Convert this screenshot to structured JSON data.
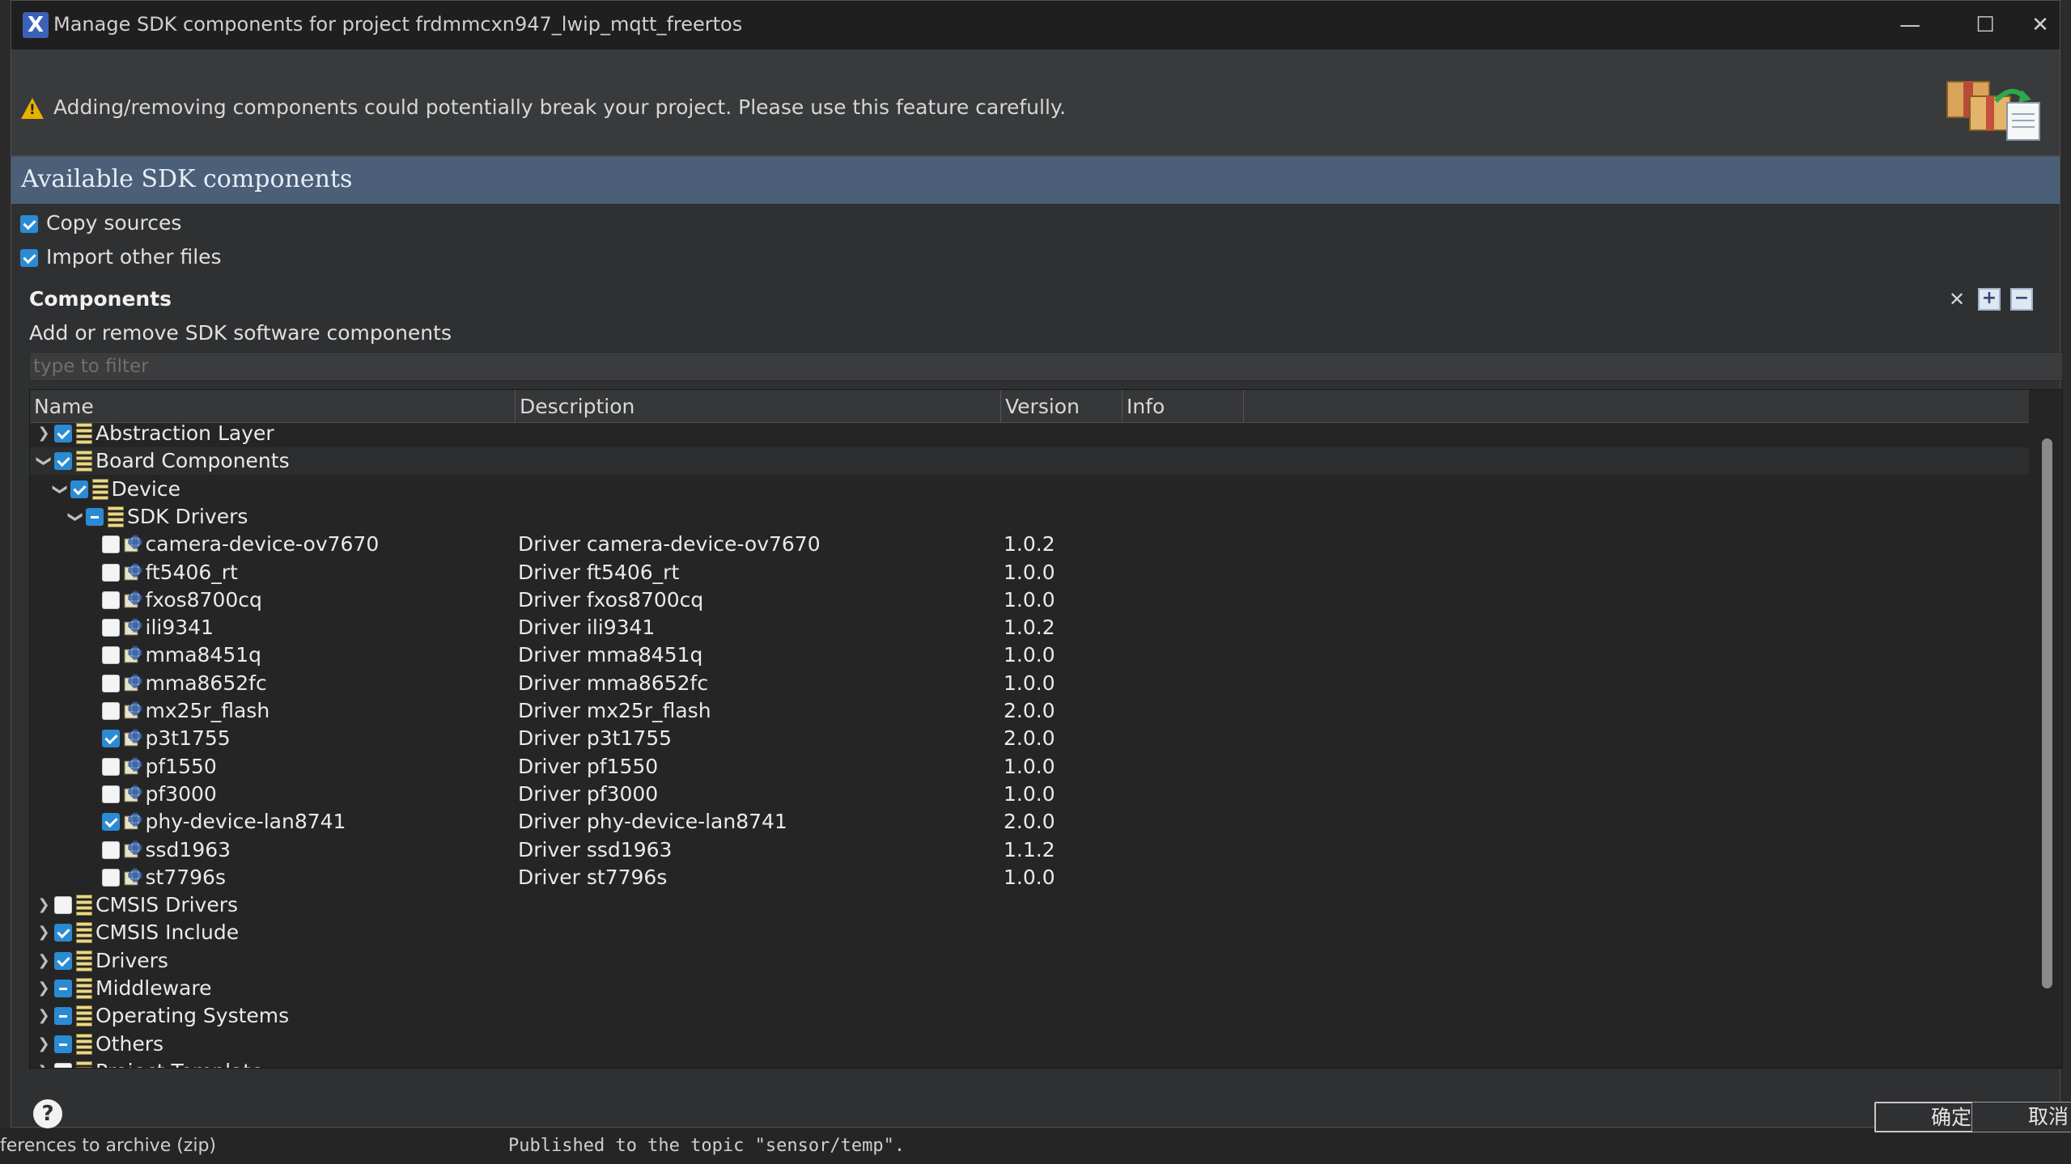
{
  "window": {
    "title": "Manage SDK components for project frdmmcxn947_lwip_mqtt_freertos",
    "minimize_glyph": "—",
    "maximize_glyph": "☐",
    "close_glyph": "✕"
  },
  "banner": {
    "warning": "Adding/removing components could potentially break your project. Please use this feature carefully."
  },
  "section": {
    "title": "Available SDK components"
  },
  "options": {
    "copy_sources": {
      "label": "Copy sources",
      "checked": true
    },
    "import_other_files": {
      "label": "Import other files",
      "checked": true
    }
  },
  "components": {
    "title": "Components",
    "subtitle": "Add or remove SDK software components",
    "filter_placeholder": "type to filter",
    "toolbar_icons": [
      "clear-filter-icon",
      "expand-all-icon",
      "collapse-all-icon"
    ]
  },
  "table": {
    "columns": [
      "Name",
      "Description",
      "Version",
      "Info"
    ],
    "rows": [
      {
        "level": 0,
        "expander": "collapsed",
        "check": "on",
        "icon": "group",
        "name": "Abstraction Layer",
        "desc": "",
        "ver": ""
      },
      {
        "level": 0,
        "expander": "expanded",
        "check": "on",
        "icon": "group",
        "name": "Board Components",
        "desc": "",
        "ver": ""
      },
      {
        "level": 1,
        "expander": "expanded",
        "check": "on",
        "icon": "group",
        "name": "Device",
        "desc": "",
        "ver": ""
      },
      {
        "level": 2,
        "expander": "expanded",
        "check": "partial",
        "icon": "group",
        "name": "SDK Drivers",
        "desc": "",
        "ver": ""
      },
      {
        "level": 3,
        "expander": "none",
        "check": "off",
        "icon": "driver",
        "name": "camera-device-ov7670",
        "desc": "Driver camera-device-ov7670",
        "ver": "1.0.2"
      },
      {
        "level": 3,
        "expander": "none",
        "check": "off",
        "icon": "driver",
        "name": "ft5406_rt",
        "desc": "Driver ft5406_rt",
        "ver": "1.0.0"
      },
      {
        "level": 3,
        "expander": "none",
        "check": "off",
        "icon": "driver",
        "name": "fxos8700cq",
        "desc": "Driver fxos8700cq",
        "ver": "1.0.0"
      },
      {
        "level": 3,
        "expander": "none",
        "check": "off",
        "icon": "driver",
        "name": "ili9341",
        "desc": "Driver ili9341",
        "ver": "1.0.2"
      },
      {
        "level": 3,
        "expander": "none",
        "check": "off",
        "icon": "driver",
        "name": "mma8451q",
        "desc": "Driver mma8451q",
        "ver": "1.0.0"
      },
      {
        "level": 3,
        "expander": "none",
        "check": "off",
        "icon": "driver",
        "name": "mma8652fc",
        "desc": "Driver mma8652fc",
        "ver": "1.0.0"
      },
      {
        "level": 3,
        "expander": "none",
        "check": "off",
        "icon": "driver",
        "name": "mx25r_flash",
        "desc": "Driver mx25r_flash",
        "ver": "2.0.0"
      },
      {
        "level": 3,
        "expander": "none",
        "check": "on",
        "icon": "driver",
        "name": "p3t1755",
        "desc": "Driver p3t1755",
        "ver": "2.0.0"
      },
      {
        "level": 3,
        "expander": "none",
        "check": "off",
        "icon": "driver",
        "name": "pf1550",
        "desc": "Driver pf1550",
        "ver": "1.0.0"
      },
      {
        "level": 3,
        "expander": "none",
        "check": "off",
        "icon": "driver",
        "name": "pf3000",
        "desc": "Driver pf3000",
        "ver": "1.0.0"
      },
      {
        "level": 3,
        "expander": "none",
        "check": "on",
        "icon": "driver",
        "name": "phy-device-lan8741",
        "desc": "Driver phy-device-lan8741",
        "ver": "2.0.0"
      },
      {
        "level": 3,
        "expander": "none",
        "check": "off",
        "icon": "driver",
        "name": "ssd1963",
        "desc": "Driver ssd1963",
        "ver": "1.1.2"
      },
      {
        "level": 3,
        "expander": "none",
        "check": "off",
        "icon": "driver",
        "name": "st7796s",
        "desc": "Driver st7796s",
        "ver": "1.0.0"
      },
      {
        "level": 0,
        "expander": "collapsed",
        "check": "off",
        "icon": "group",
        "name": "CMSIS Drivers",
        "desc": "",
        "ver": ""
      },
      {
        "level": 0,
        "expander": "collapsed",
        "check": "on",
        "icon": "group",
        "name": "CMSIS Include",
        "desc": "",
        "ver": ""
      },
      {
        "level": 0,
        "expander": "collapsed",
        "check": "on",
        "icon": "group",
        "name": "Drivers",
        "desc": "",
        "ver": ""
      },
      {
        "level": 0,
        "expander": "collapsed",
        "check": "partial",
        "icon": "group",
        "name": "Middleware",
        "desc": "",
        "ver": ""
      },
      {
        "level": 0,
        "expander": "collapsed",
        "check": "partial",
        "icon": "group",
        "name": "Operating Systems",
        "desc": "",
        "ver": ""
      },
      {
        "level": 0,
        "expander": "collapsed",
        "check": "partial",
        "icon": "group",
        "name": "Others",
        "desc": "",
        "ver": ""
      },
      {
        "level": 0,
        "expander": "collapsed",
        "check": "off",
        "icon": "group",
        "name": "Project Template",
        "desc": "",
        "ver": ""
      }
    ]
  },
  "footer": {
    "help_glyph": "?",
    "ok_label": "确定",
    "cancel_label": "取消"
  },
  "background": {
    "left_text": "ferences to archive (zip)",
    "console_text": "Published to the topic \"sensor/temp\"."
  },
  "colors": {
    "accent": "#2a8bd3",
    "section_header": "#4b5f79",
    "warning": "#e8b100"
  }
}
